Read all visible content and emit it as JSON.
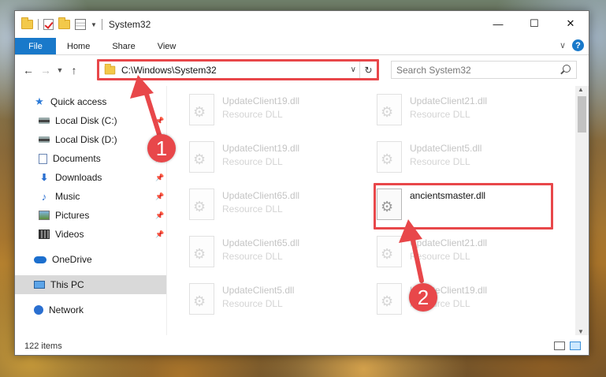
{
  "titlebar": {
    "title": "System32",
    "controls": [
      "—",
      "☐",
      "✕"
    ]
  },
  "ribbon": {
    "tabs": [
      "File",
      "Home",
      "Share",
      "View"
    ]
  },
  "nav": {
    "address": "C:\\Windows\\System32",
    "search_placeholder": "Search System32"
  },
  "sidebar": {
    "quick_access": "Quick access",
    "items": [
      "Local Disk (C:)",
      "Local Disk (D:)",
      "Documents",
      "Downloads",
      "Music",
      "Pictures",
      "Videos"
    ],
    "onedrive": "OneDrive",
    "thispc": "This PC",
    "network": "Network"
  },
  "files": {
    "left": [
      {
        "name": "UpdateClient19.dll",
        "desc": "Resource DLL"
      },
      {
        "name": "UpdateClient19.dll",
        "desc": "Resource DLL"
      },
      {
        "name": "UpdateClient65.dll",
        "desc": "Resource DLL"
      },
      {
        "name": "UpdateClient65.dll",
        "desc": "Resource DLL"
      },
      {
        "name": "UpdateClient5.dll",
        "desc": "Resource DLL"
      }
    ],
    "right": [
      {
        "name": "UpdateClient21.dll",
        "desc": "Resource DLL"
      },
      {
        "name": "UpdateClient5.dll",
        "desc": "Resource DLL"
      },
      {
        "name": "ancientsmaster.dll",
        "desc": ""
      },
      {
        "name": "UpdateClient21.dll",
        "desc": "Resource DLL"
      },
      {
        "name": "UpdateClient19.dll",
        "desc": "Resource DLL"
      }
    ]
  },
  "status": {
    "count": "122 items"
  },
  "callouts": {
    "one": "1",
    "two": "2"
  },
  "colors": {
    "accent": "#1979ca",
    "highlight": "#e8474a"
  }
}
